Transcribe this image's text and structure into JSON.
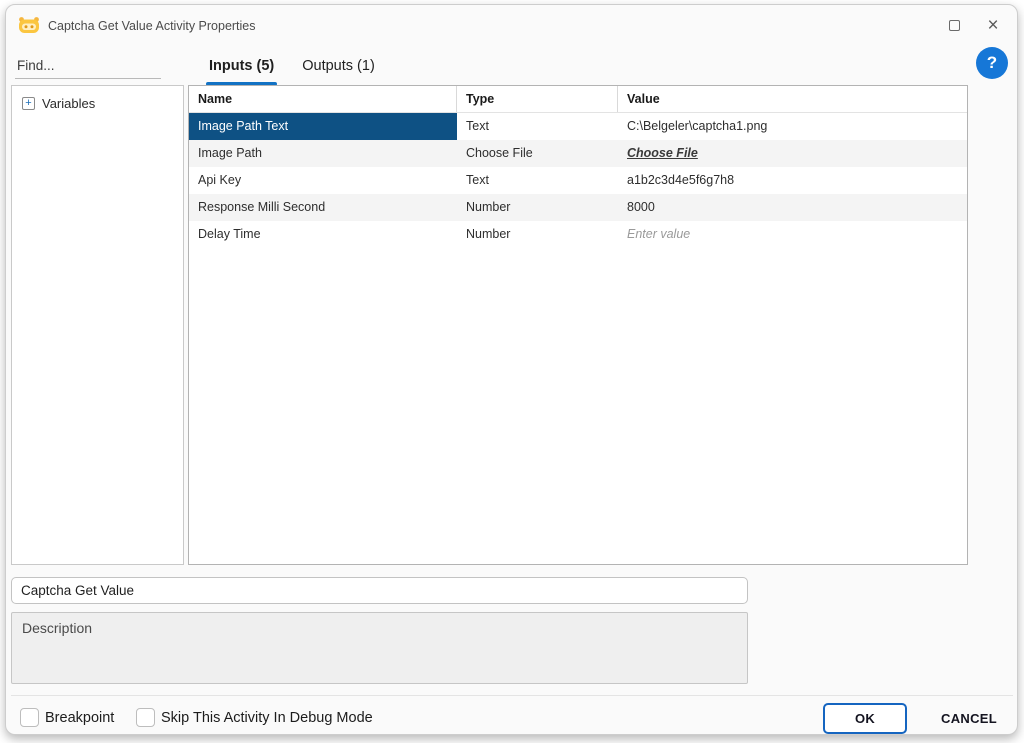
{
  "window": {
    "title": "Captcha Get Value Activity Properties",
    "maximize_label": "maximize",
    "close_label": "×"
  },
  "colors": {
    "selection_blue": "#0e5184",
    "tab_underline": "#1272c4",
    "help_blue": "#1677d7",
    "ok_border": "#1565c0",
    "icon_yellow": "#fbc640"
  },
  "sidebar": {
    "find_placeholder": "Find...",
    "tree": {
      "expander": "+",
      "label": "Variables"
    }
  },
  "tabs": [
    {
      "label": "Inputs (5)",
      "active": true
    },
    {
      "label": "Outputs (1)",
      "active": false
    }
  ],
  "help": {
    "label": "?"
  },
  "table": {
    "columns": [
      "Name",
      "Type",
      "Value"
    ],
    "rows": [
      {
        "name": "Image Path Text",
        "type": "Text",
        "value": "C:\\Belgeler\\captcha1.png",
        "selected": true,
        "value_kind": "text"
      },
      {
        "name": "Image Path",
        "type": "Choose File",
        "value": "Choose File",
        "selected": false,
        "value_kind": "link"
      },
      {
        "name": "Api Key",
        "type": "Text",
        "value": "a1b2c3d4e5f6g7h8",
        "selected": false,
        "value_kind": "text"
      },
      {
        "name": "Response Milli Second",
        "type": "Number",
        "value": "8000",
        "selected": false,
        "value_kind": "text"
      },
      {
        "name": "Delay Time",
        "type": "Number",
        "value": "Enter value",
        "selected": false,
        "value_kind": "placeholder"
      }
    ]
  },
  "name_field": {
    "value": "Captcha Get Value"
  },
  "description_field": {
    "placeholder": "Description"
  },
  "footer": {
    "checkboxes": [
      {
        "label": "Breakpoint",
        "checked": false
      },
      {
        "label": "Skip This Activity In Debug Mode",
        "checked": false
      }
    ],
    "ok_label": "OK",
    "cancel_label": "CANCEL"
  }
}
